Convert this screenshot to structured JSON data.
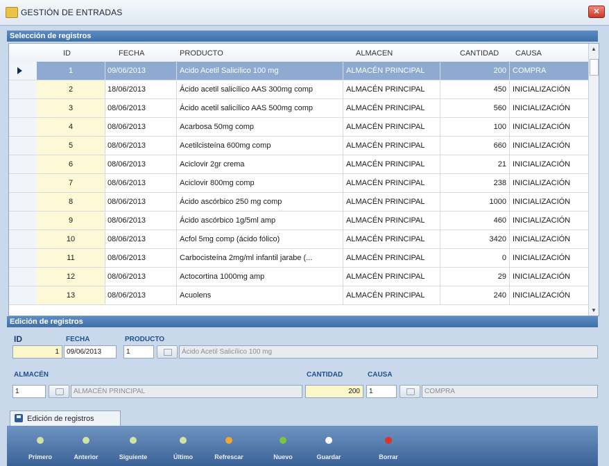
{
  "window": {
    "title": "GESTIÓN DE ENTRADAS",
    "close_icon": "close-icon"
  },
  "selection": {
    "title": "Selección de registros",
    "columns": [
      "ID",
      "FECHA",
      "PRODUCTO",
      "ALMACEN",
      "CANTIDAD",
      "CAUSA"
    ],
    "rows": [
      {
        "id": "1",
        "fecha": "09/06/2013",
        "producto": "Acido Acetil Salicilico 100 mg",
        "almacen": "ALMACÉN PRINCIPAL",
        "cantidad": "200",
        "causa": "COMPRA"
      },
      {
        "id": "2",
        "fecha": "18/06/2013",
        "producto": "Ácido acetil salicílico AAS 300mg comp",
        "almacen": "ALMACÉN PRINCIPAL",
        "cantidad": "450",
        "causa": "INICIALIZACIÓN"
      },
      {
        "id": "3",
        "fecha": "08/06/2013",
        "producto": "Ácido acetil salicílico AAS 500mg comp",
        "almacen": "ALMACÉN PRINCIPAL",
        "cantidad": "560",
        "causa": "INICIALIZACIÓN"
      },
      {
        "id": "4",
        "fecha": "08/06/2013",
        "producto": "Acarbosa 50mg comp",
        "almacen": "ALMACÉN PRINCIPAL",
        "cantidad": "100",
        "causa": "INICIALIZACIÓN"
      },
      {
        "id": "5",
        "fecha": "08/06/2013",
        "producto": "Acetilcisteína 600mg comp",
        "almacen": "ALMACÉN PRINCIPAL",
        "cantidad": "660",
        "causa": "INICIALIZACIÓN"
      },
      {
        "id": "6",
        "fecha": "08/06/2013",
        "producto": "Aciclovir 2gr crema",
        "almacen": "ALMACÉN PRINCIPAL",
        "cantidad": "21",
        "causa": "INICIALIZACIÓN"
      },
      {
        "id": "7",
        "fecha": "08/06/2013",
        "producto": "Aciclovir 800mg comp",
        "almacen": "ALMACÉN PRINCIPAL",
        "cantidad": "238",
        "causa": "INICIALIZACIÓN"
      },
      {
        "id": "8",
        "fecha": "08/06/2013",
        "producto": "Ácido ascórbico 250 mg comp",
        "almacen": "ALMACÉN PRINCIPAL",
        "cantidad": "1000",
        "causa": "INICIALIZACIÓN"
      },
      {
        "id": "9",
        "fecha": "08/06/2013",
        "producto": "Ácido ascórbico 1g/5ml amp",
        "almacen": "ALMACÉN PRINCIPAL",
        "cantidad": "460",
        "causa": "INICIALIZACIÓN"
      },
      {
        "id": "10",
        "fecha": "08/06/2013",
        "producto": "Acfol 5mg comp (ácido fólico)",
        "almacen": "ALMACÉN PRINCIPAL",
        "cantidad": "3420",
        "causa": "INICIALIZACIÓN"
      },
      {
        "id": "11",
        "fecha": "08/06/2013",
        "producto": "Carbocisteína 2mg/ml infantil jarabe (...",
        "almacen": "ALMACÉN PRINCIPAL",
        "cantidad": "0",
        "causa": "INICIALIZACIÓN"
      },
      {
        "id": "12",
        "fecha": "08/06/2013",
        "producto": "Actocortina 1000mg amp",
        "almacen": "ALMACÉN PRINCIPAL",
        "cantidad": "29",
        "causa": "INICIALIZACIÓN"
      },
      {
        "id": "13",
        "fecha": "08/06/2013",
        "producto": "Acuolens",
        "almacen": "ALMACÉN PRINCIPAL",
        "cantidad": "240",
        "causa": "INICIALIZACIÓN"
      }
    ]
  },
  "edition": {
    "title": "Edición de registros",
    "labels": {
      "id": "ID",
      "fecha": "FECHA",
      "producto": "PRODUCTO",
      "almacen": "ALMACÉN",
      "cantidad": "CANTIDAD",
      "causa": "CAUSA"
    },
    "values": {
      "id": "1",
      "fecha": "09/06/2013",
      "producto_id": "1",
      "producto_name": "Ácido Acetil Salicílico 100 mg",
      "almacen_id": "1",
      "almacen_name": "ALMACÉN PRINCIPAL",
      "cantidad": "200",
      "causa_id": "1",
      "causa_name": "COMPRA"
    },
    "tab_label": "Edición de registros"
  },
  "toolbar": [
    {
      "label": "Primero",
      "icon": "first-icon",
      "color": "#cfe3a4"
    },
    {
      "label": "Anterior",
      "icon": "previous-icon",
      "color": "#cfe3a4"
    },
    {
      "label": "Siguiente",
      "icon": "next-icon",
      "color": "#cfe3a4"
    },
    {
      "label": "Último",
      "icon": "last-icon",
      "color": "#cfe3a4"
    },
    {
      "label": "Refrescar",
      "icon": "refresh-icon",
      "color": "#f2a530"
    },
    {
      "label": "Nuevo",
      "icon": "new-icon",
      "color": "#7bc63d"
    },
    {
      "label": "Guardar",
      "icon": "save-icon",
      "color": "#ffffff"
    },
    {
      "label": "Borrar",
      "icon": "delete-icon",
      "color": "#e0302a"
    }
  ],
  "colors": {
    "header": "#4a7ab5",
    "selected_row": "#8eaad0",
    "id_cell": "#fdf9d6"
  }
}
